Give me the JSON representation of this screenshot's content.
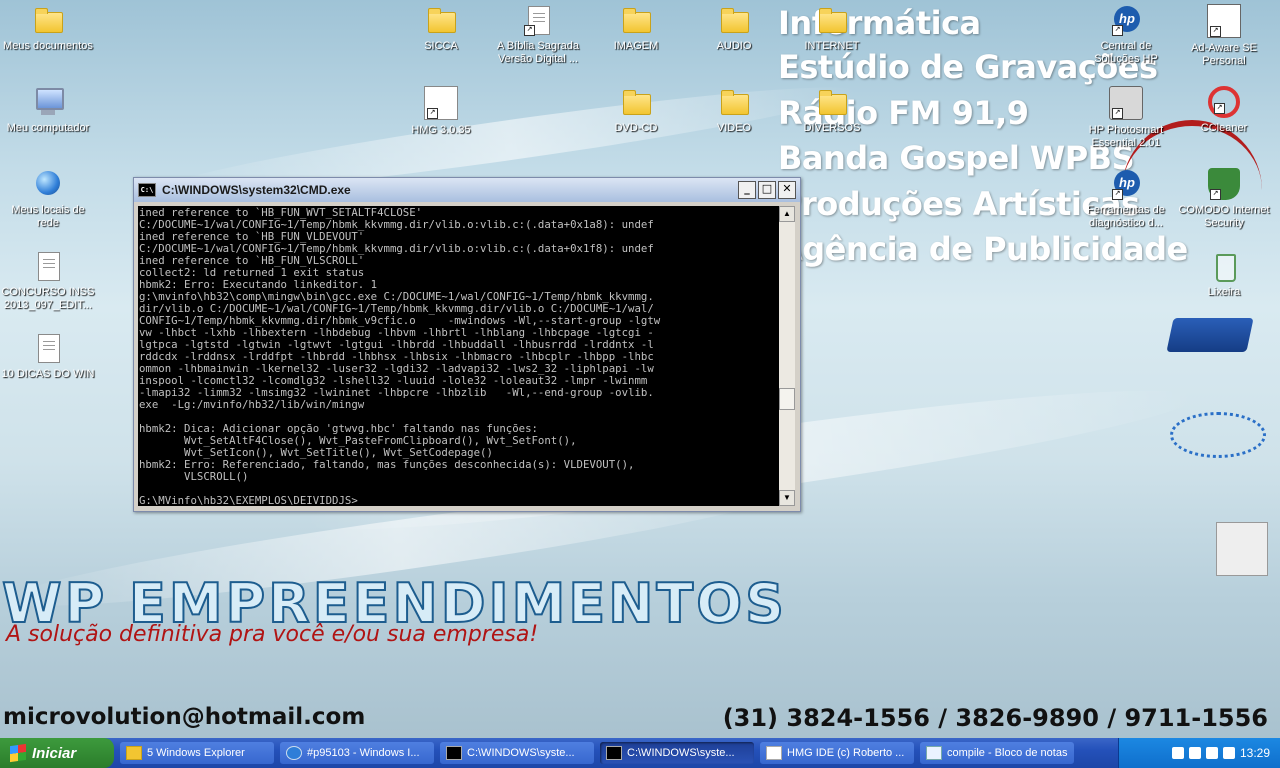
{
  "desktop_icons": {
    "meus_documentos": "Meus documentos",
    "meu_computador": "Meu computador",
    "meus_locais": "Meus locais de rede",
    "concurso": "CONCURSO INSS 2013_097_EDIT...",
    "dicas": "10 DICAS DO WIN",
    "sicca": "SICCA",
    "biblia": "A Bíblia Sagrada Versão Digital ...",
    "hmg": "HMG 3.0.35",
    "imagem": "IMAGEM",
    "audio": "AUDIO",
    "internet": "INTERNET",
    "dvd": "DVD-CD",
    "video": "VIDEO",
    "diversos": "DIVERSOS",
    "central_hp": "Central de Soluções HP",
    "adaware": "Ad-Aware SE Personal",
    "hp_photosmart": "HP Photosmart Essential 2.01",
    "ccleaner": "CCleaner",
    "ferramentas": "Ferramentas de diagnóstico d...",
    "comodo": "COMODO Internet Security",
    "lixeira": "Lixeira"
  },
  "wallpaper": {
    "lines": [
      "Informática",
      "Estúdio de Gravações",
      "Rádio FM 91,9",
      "Banda Gospel WPBS",
      "Produções Artísticas",
      "Agência de Publicidade"
    ],
    "brand": "WP EMPREENDIMENTOS",
    "slogan": "A solução definitiva pra você e/ou sua empresa!",
    "email": "microvolution@hotmail.com",
    "phones": "(31) 3824-1556 / 3826-9890 / 9711-1556"
  },
  "cmd": {
    "title": "C:\\WINDOWS\\system32\\CMD.exe",
    "output": "ined reference to `HB_FUN_WVT_SETALTF4CLOSE'\nC:/DOCUME~1/wal/CONFIG~1/Temp/hbmk_kkvmmg.dir/vlib.o:vlib.c:(.data+0x1a8): undef\nined reference to `HB_FUN_VLDEVOUT'\nC:/DOCUME~1/wal/CONFIG~1/Temp/hbmk_kkvmmg.dir/vlib.o:vlib.c:(.data+0x1f8): undef\nined reference to `HB_FUN_VLSCROLL'\ncollect2: ld returned 1 exit status\nhbmk2: Erro: Executando linkeditor. 1\ng:\\mvinfo\\hb32\\comp\\mingw\\bin\\gcc.exe C:/DOCUME~1/wal/CONFIG~1/Temp/hbmk_kkvmmg.\ndir/vlib.o C:/DOCUME~1/wal/CONFIG~1/Temp/hbmk_kkvmmg.dir/vlib.o C:/DOCUME~1/wal/\nCONFIG~1/Temp/hbmk_kkvmmg.dir/hbmk_v9cfic.o     -mwindows -Wl,--start-group -lgtw\nvw -lhbct -lxhb -lhbextern -lhbdebug -lhbvm -lhbrtl -lhblang -lhbcpage -lgtcgi -\nlgtpca -lgtstd -lgtwin -lgtwvt -lgtgui -lhbrdd -lhbuddall -lhbusrrdd -lrddntx -l\nrddcdx -lrddnsx -lrddfpt -lhbrdd -lhbhsx -lhbsix -lhbmacro -lhbcplr -lhbpp -lhbc\nommon -lhbmainwin -lkernel32 -luser32 -lgdi32 -ladvapi32 -lws2_32 -liphlpapi -lw\ninspool -lcomctl32 -lcomdlg32 -lshell32 -luuid -lole32 -loleaut32 -lmpr -lwinmm\n-lmapi32 -limm32 -lmsimg32 -lwininet -lhbpcre -lhbzlib   -Wl,--end-group -ovlib.\nexe  -Lg:/mvinfo/hb32/lib/win/mingw\n\nhbmk2: Dica: Adicionar opção 'gtwvg.hbc' faltando nas funções:\n       Wvt_SetAltF4Close(), Wvt_PasteFromClipboard(), Wvt_SetFont(),\n       Wvt_SetIcon(), Wvt_SetTitle(), Wvt_SetCodepage()\nhbmk2: Erro: Referenciado, faltando, mas funções desconhecida(s): VLDEVOUT(),\n       VLSCROLL()\n\nG:\\MVinfo\\hb32\\EXEMPLOS\\DEIVIDDJS>"
  },
  "taskbar": {
    "start_label": "Iniciar",
    "tasks": [
      {
        "label": "5 Windows Explorer",
        "icon": "folder-icon"
      },
      {
        "label": "#p95103 - Windows I...",
        "icon": "ie-icon"
      },
      {
        "label": "C:\\WINDOWS\\syste...",
        "icon": "cmd-icon"
      },
      {
        "label": "C:\\WINDOWS\\syste...",
        "icon": "cmd-icon"
      },
      {
        "label": "HMG IDE (c) Roberto ...",
        "icon": "hmg-icon"
      },
      {
        "label": "compile - Bloco de notas",
        "icon": "notepad-icon"
      }
    ],
    "clock": "13:29"
  }
}
